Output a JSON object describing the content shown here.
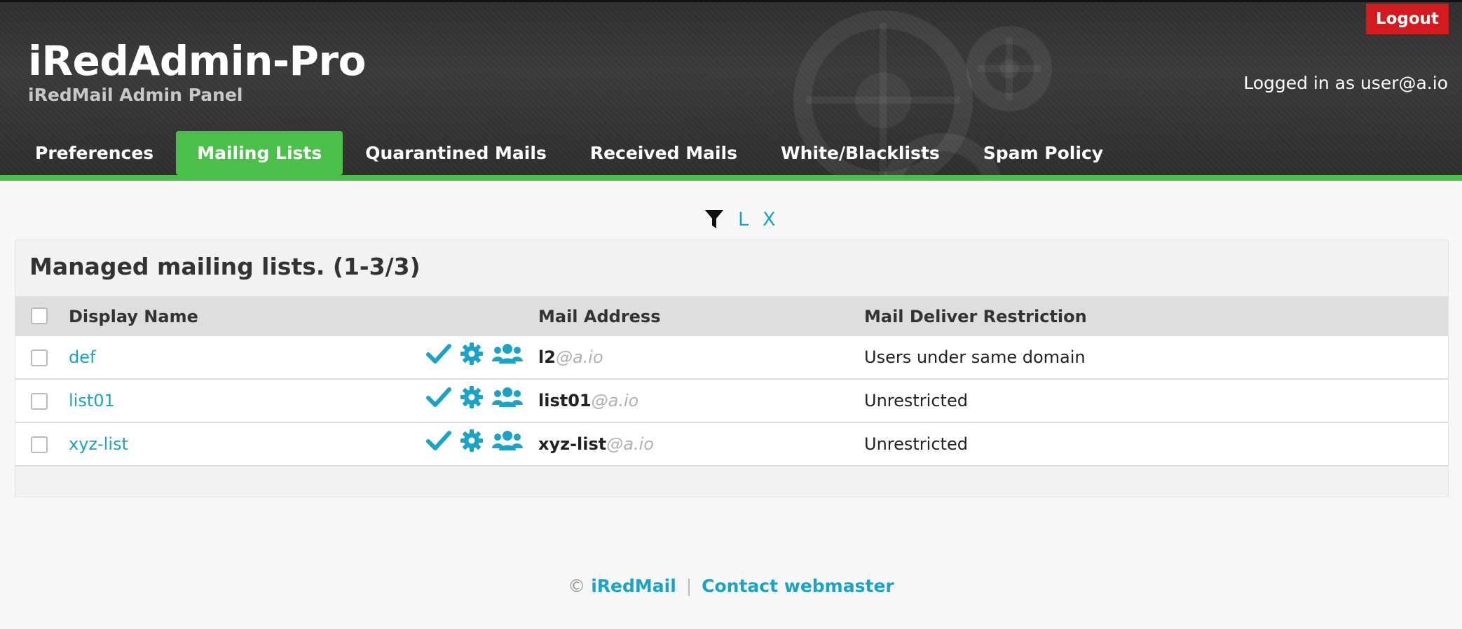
{
  "header": {
    "title": "iRedAdmin-Pro",
    "subtitle": "iRedMail Admin Panel",
    "logout_label": "Logout",
    "logged_in_text": "Logged in as user@a.io"
  },
  "nav": {
    "items": [
      {
        "label": "Preferences",
        "active": false
      },
      {
        "label": "Mailing Lists",
        "active": true
      },
      {
        "label": "Quarantined Mails",
        "active": false
      },
      {
        "label": "Received Mails",
        "active": false
      },
      {
        "label": "White/Blacklists",
        "active": false
      },
      {
        "label": "Spam Policy",
        "active": false
      }
    ]
  },
  "filter": {
    "icon": "filter-icon",
    "letters": [
      "L",
      "X"
    ]
  },
  "panel": {
    "title": "Managed mailing lists. (1-3/3)",
    "columns": {
      "display_name": "Display Name",
      "mail_address": "Mail Address",
      "restriction": "Mail Deliver Restriction"
    },
    "rows": [
      {
        "name": "def",
        "user": "l2",
        "domain": "@a.io",
        "restriction": "Users under same domain"
      },
      {
        "name": "list01",
        "user": "list01",
        "domain": "@a.io",
        "restriction": "Unrestricted"
      },
      {
        "name": "xyz-list",
        "user": "xyz-list",
        "domain": "@a.io",
        "restriction": "Unrestricted"
      }
    ],
    "row_icons": [
      "check-icon",
      "gear-icon",
      "users-icon"
    ]
  },
  "footer": {
    "copyright": "©",
    "brand": "iRedMail",
    "separator": "|",
    "contact": "Contact webmaster"
  },
  "colors": {
    "accent_green": "#4cbf4a",
    "link_blue": "#1aa3c7",
    "logout_red": "#d31a1f",
    "header_dark": "#333333"
  }
}
